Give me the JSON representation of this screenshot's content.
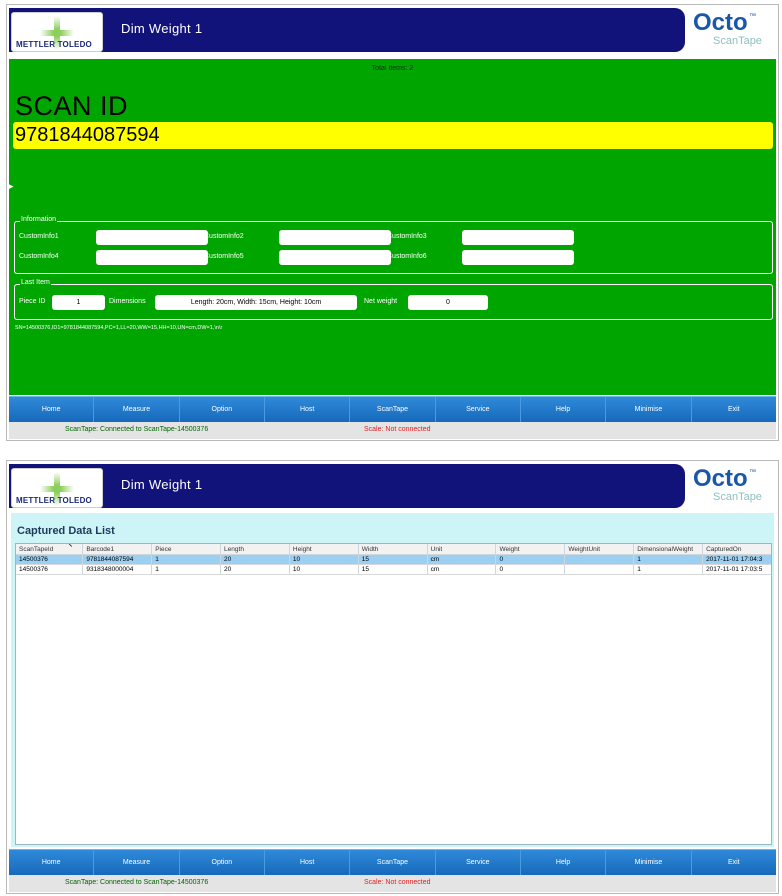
{
  "app": {
    "brand_logo": "METTLER TOLEDO",
    "title": "Dim Weight  1",
    "octo_logo": "Octo",
    "octo_tm": "™",
    "octo_sub": "ScanTape"
  },
  "scan": {
    "total_items": "Total Items: 2",
    "scan_label": "SCAN ID",
    "scan_value": "9781844087594"
  },
  "information": {
    "legend": "Information",
    "fields": [
      {
        "label": "CustomInfo1",
        "value": ""
      },
      {
        "label": "CustomInfo2",
        "value": ""
      },
      {
        "label": "CustomInfo3",
        "value": ""
      },
      {
        "label": "CustomInfo4",
        "value": ""
      },
      {
        "label": "CustomInfo5",
        "value": ""
      },
      {
        "label": "CustomInfo6",
        "value": ""
      }
    ]
  },
  "last_item": {
    "legend": "Last Item",
    "piece_id_label": "Piece ID",
    "piece_id_value": "1",
    "dimensions_label": "Dimensions",
    "dimensions_value": "Length: 20cm, Width: 15cm, Height: 10cm",
    "net_weight_label": "Net weight",
    "net_weight_value": "0"
  },
  "raw_string": "SN=14500376,ID1=9781844087594,PC=1,LL=20,WW=15,HH=10,UN=cm,DW=1,\\n\\r",
  "nav": [
    "Home",
    "Measure",
    "Option",
    "Host",
    "ScanTape",
    "Service",
    "Help",
    "Minimise",
    "Exit"
  ],
  "status": {
    "scantape": "ScanTape: Connected to ScanTape-14500376",
    "scale": "Scale: Not connected"
  },
  "captured": {
    "title": "Captured Data List",
    "columns": [
      "ScanTapeId",
      "Barcode1",
      "Piece",
      "Length",
      "Height",
      "Width",
      "Unit",
      "Weight",
      "WeightUnit",
      "DimensionalWeight",
      "CapturedOn"
    ],
    "rows": [
      [
        "14500376",
        "9781844087594",
        "1",
        "20",
        "10",
        "15",
        "cm",
        "0",
        "",
        "1",
        "2017-11-01 17:04:3"
      ],
      [
        "14500376",
        "9318348000004",
        "1",
        "20",
        "10",
        "15",
        "cm",
        "0",
        "",
        "1",
        "2017-11-01 17:03:5"
      ]
    ]
  },
  "colors": {
    "title_bar": "#12137a",
    "panel_green": "#00a500",
    "scan_highlight": "#ffff00",
    "nav_blue": "#1668b9",
    "list_background": "#cdf5f7",
    "selected_row": "#9bd0f3",
    "status_ok": "#006400",
    "status_error": "#e02020"
  }
}
